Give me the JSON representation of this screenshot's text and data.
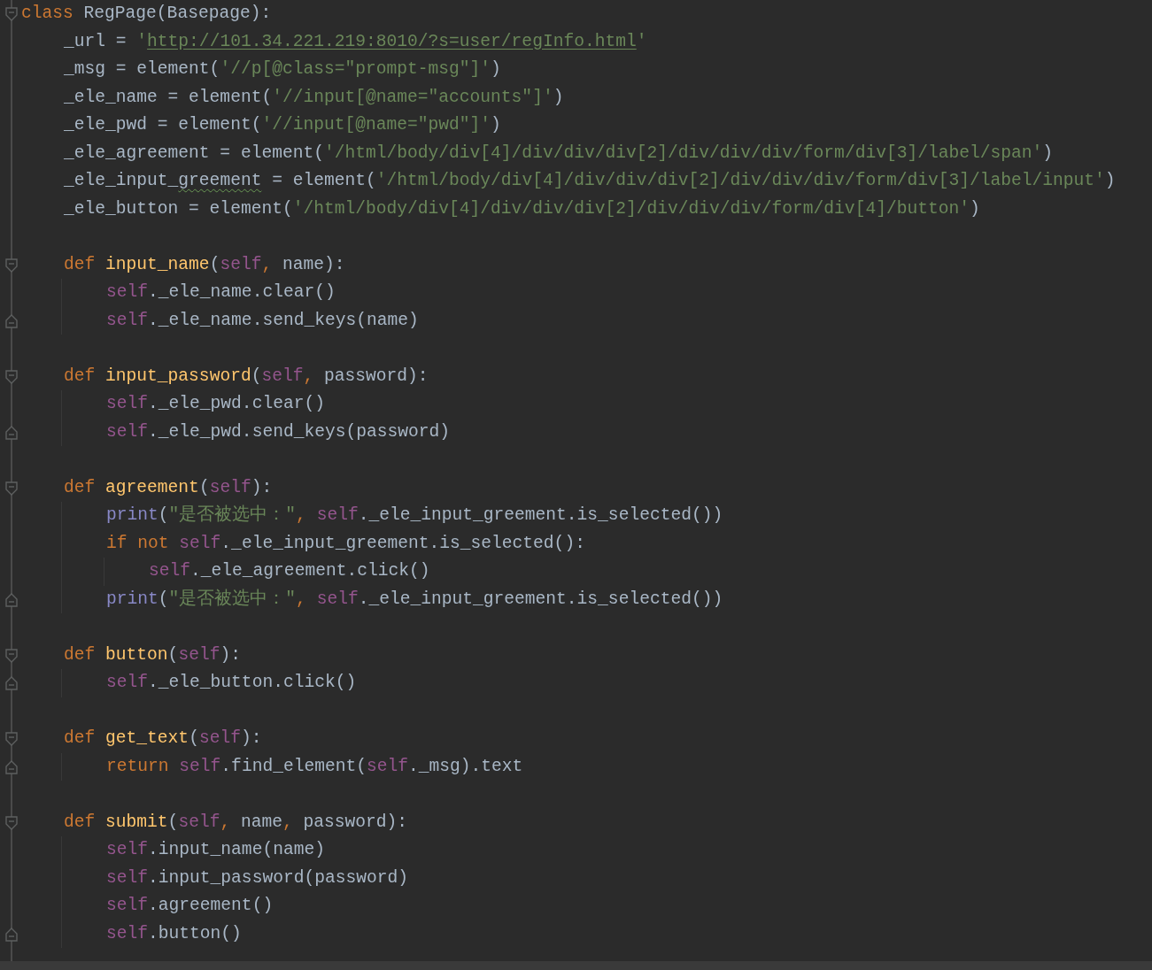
{
  "editor": {
    "lines": [
      {
        "tokens": [
          {
            "kind": "keyword",
            "text": "class"
          },
          {
            "kind": "plain",
            "text": " RegPage(Basepage):"
          }
        ],
        "children": [
          {
            "tokens": [
              {
                "kind": "plain",
                "text": "_url = "
              },
              {
                "kind": "string",
                "text": "'"
              },
              {
                "kind": "url",
                "text": "http://101.34.221.219:8010/?s=user/regInfo.html"
              },
              {
                "kind": "string",
                "text": "'"
              }
            ]
          },
          {
            "tokens": [
              {
                "kind": "plain",
                "text": "_msg = element("
              },
              {
                "kind": "string",
                "text": "'//p[@class=\"prompt-msg\"]'"
              },
              {
                "kind": "plain",
                "text": ")"
              }
            ]
          },
          {
            "tokens": [
              {
                "kind": "plain",
                "text": "_ele_name = element("
              },
              {
                "kind": "string",
                "text": "'//input[@name=\"accounts\"]'"
              },
              {
                "kind": "plain",
                "text": ")"
              }
            ]
          },
          {
            "tokens": [
              {
                "kind": "plain",
                "text": "_ele_pwd = element("
              },
              {
                "kind": "string",
                "text": "'//input[@name=\"pwd\"]'"
              },
              {
                "kind": "plain",
                "text": ")"
              }
            ]
          },
          {
            "tokens": [
              {
                "kind": "plain",
                "text": "_ele_agreement = element("
              },
              {
                "kind": "string",
                "text": "'/html/body/div[4]/div/div/div[2]/div/div/div/form/div[3]/label/span'"
              },
              {
                "kind": "plain",
                "text": ")"
              }
            ]
          },
          {
            "tokens": [
              {
                "kind": "plain",
                "text": "_ele_input_"
              },
              {
                "kind": "typo",
                "text": "greement"
              },
              {
                "kind": "plain",
                "text": " = element("
              },
              {
                "kind": "string",
                "text": "'/html/body/div[4]/div/div/div[2]/div/div/div/form/div[3]/label/input'"
              },
              {
                "kind": "plain",
                "text": ")"
              }
            ]
          },
          {
            "tokens": [
              {
                "kind": "plain",
                "text": "_ele_button = element("
              },
              {
                "kind": "string",
                "text": "'/html/body/div[4]/div/div/div[2]/div/div/div/form/div[4]/button'"
              },
              {
                "kind": "plain",
                "text": ")"
              }
            ]
          },
          {
            "tokens": [
              {
                "kind": "keyword",
                "text": "def "
              },
              {
                "kind": "function",
                "text": "input_name"
              },
              {
                "kind": "plain",
                "text": "("
              },
              {
                "kind": "self",
                "text": "self"
              },
              {
                "kind": "keyword",
                "text": ", "
              },
              {
                "kind": "plain",
                "text": "name):"
              }
            ],
            "children": [
              {
                "tokens": [
                  {
                    "kind": "self",
                    "text": "self"
                  },
                  {
                    "kind": "plain",
                    "text": "._ele_name.clear()"
                  }
                ]
              },
              {
                "tokens": [
                  {
                    "kind": "self",
                    "text": "self"
                  },
                  {
                    "kind": "plain",
                    "text": "._ele_name.send_keys(name)"
                  }
                ]
              }
            ]
          },
          {
            "tokens": [
              {
                "kind": "keyword",
                "text": "def "
              },
              {
                "kind": "function",
                "text": "input_password"
              },
              {
                "kind": "plain",
                "text": "("
              },
              {
                "kind": "self",
                "text": "self"
              },
              {
                "kind": "keyword",
                "text": ", "
              },
              {
                "kind": "plain",
                "text": "password):"
              }
            ],
            "children": [
              {
                "tokens": [
                  {
                    "kind": "self",
                    "text": "self"
                  },
                  {
                    "kind": "plain",
                    "text": "._ele_pwd.clear()"
                  }
                ]
              },
              {
                "tokens": [
                  {
                    "kind": "self",
                    "text": "self"
                  },
                  {
                    "kind": "plain",
                    "text": "._ele_pwd.send_keys(password)"
                  }
                ]
              }
            ]
          },
          {
            "tokens": [
              {
                "kind": "keyword",
                "text": "def "
              },
              {
                "kind": "function",
                "text": "agreement"
              },
              {
                "kind": "plain",
                "text": "("
              },
              {
                "kind": "self",
                "text": "self"
              },
              {
                "kind": "plain",
                "text": "):"
              }
            ],
            "children": [
              {
                "tokens": [
                  {
                    "kind": "builtin",
                    "text": "print"
                  },
                  {
                    "kind": "plain",
                    "text": "("
                  },
                  {
                    "kind": "string",
                    "text": "\"是否被选中：\""
                  },
                  {
                    "kind": "keyword",
                    "text": ", "
                  },
                  {
                    "kind": "self",
                    "text": "self"
                  },
                  {
                    "kind": "plain",
                    "text": "._ele_input_greement.is_selected())"
                  }
                ]
              },
              {
                "tokens": [
                  {
                    "kind": "keyword",
                    "text": "if not "
                  },
                  {
                    "kind": "self",
                    "text": "self"
                  },
                  {
                    "kind": "plain",
                    "text": "._ele_input_greement.is_selected():"
                  }
                ],
                "children": [
                  {
                    "tokens": [
                      {
                        "kind": "self",
                        "text": "self"
                      },
                      {
                        "kind": "plain",
                        "text": "._ele_agreement.click()"
                      }
                    ]
                  }
                ]
              },
              {
                "tokens": [
                  {
                    "kind": "builtin",
                    "text": "print"
                  },
                  {
                    "kind": "plain",
                    "text": "("
                  },
                  {
                    "kind": "string",
                    "text": "\"是否被选中：\""
                  },
                  {
                    "kind": "keyword",
                    "text": ", "
                  },
                  {
                    "kind": "self",
                    "text": "self"
                  },
                  {
                    "kind": "plain",
                    "text": "._ele_input_greement.is_selected())"
                  }
                ]
              }
            ]
          },
          {
            "tokens": [
              {
                "kind": "keyword",
                "text": "def "
              },
              {
                "kind": "function",
                "text": "button"
              },
              {
                "kind": "plain",
                "text": "("
              },
              {
                "kind": "self",
                "text": "self"
              },
              {
                "kind": "plain",
                "text": "):"
              }
            ],
            "children": [
              {
                "tokens": [
                  {
                    "kind": "self",
                    "text": "self"
                  },
                  {
                    "kind": "plain",
                    "text": "._ele_button.click()"
                  }
                ]
              }
            ]
          },
          {
            "tokens": [
              {
                "kind": "keyword",
                "text": "def "
              },
              {
                "kind": "function",
                "text": "get_text"
              },
              {
                "kind": "plain",
                "text": "("
              },
              {
                "kind": "self",
                "text": "self"
              },
              {
                "kind": "plain",
                "text": "):"
              }
            ],
            "children": [
              {
                "tokens": [
                  {
                    "kind": "keyword",
                    "text": "return "
                  },
                  {
                    "kind": "self",
                    "text": "self"
                  },
                  {
                    "kind": "plain",
                    "text": ".find_element("
                  },
                  {
                    "kind": "self",
                    "text": "self"
                  },
                  {
                    "kind": "plain",
                    "text": "._msg).text"
                  }
                ]
              }
            ]
          },
          {
            "tokens": [
              {
                "kind": "keyword",
                "text": "def "
              },
              {
                "kind": "function",
                "text": "submit"
              },
              {
                "kind": "plain",
                "text": "("
              },
              {
                "kind": "self",
                "text": "self"
              },
              {
                "kind": "keyword",
                "text": ", "
              },
              {
                "kind": "plain",
                "text": "name"
              },
              {
                "kind": "keyword",
                "text": ", "
              },
              {
                "kind": "plain",
                "text": "password):"
              }
            ],
            "children": [
              {
                "tokens": [
                  {
                    "kind": "self",
                    "text": "self"
                  },
                  {
                    "kind": "plain",
                    "text": ".input_name(name)"
                  }
                ]
              },
              {
                "tokens": [
                  {
                    "kind": "self",
                    "text": "self"
                  },
                  {
                    "kind": "plain",
                    "text": ".input_password(password)"
                  }
                ]
              },
              {
                "tokens": [
                  {
                    "kind": "self",
                    "text": "self"
                  },
                  {
                    "kind": "plain",
                    "text": ".agreement()"
                  }
                ]
              },
              {
                "tokens": [
                  {
                    "kind": "self",
                    "text": "self"
                  },
                  {
                    "kind": "plain",
                    "text": ".button()"
                  }
                ]
              }
            ]
          }
        ]
      }
    ]
  }
}
